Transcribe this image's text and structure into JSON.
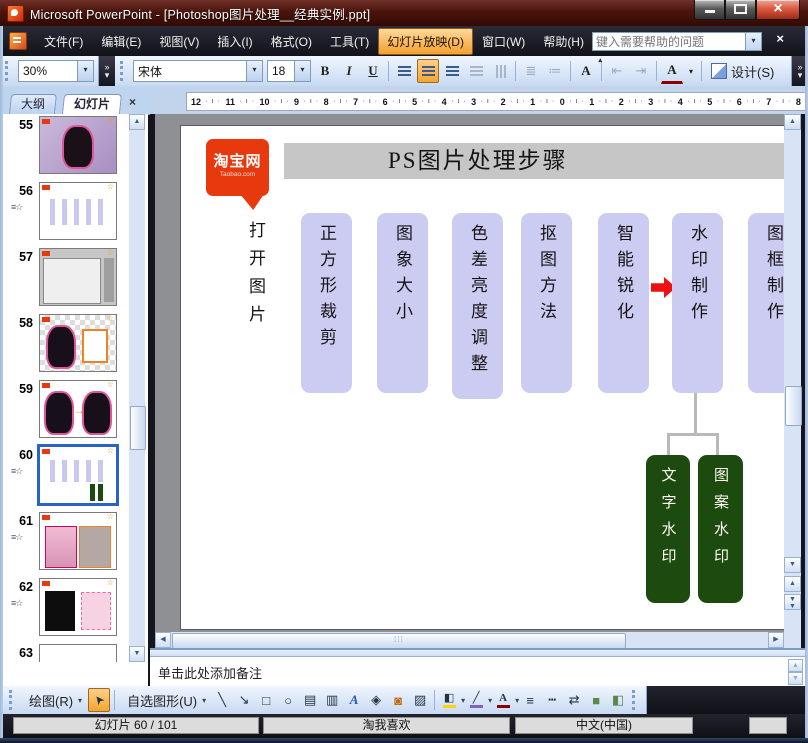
{
  "window": {
    "title": "Microsoft PowerPoint - [Photoshop图片处理__经典实例.ppt]"
  },
  "menu_bar": {
    "items": [
      "文件(F)",
      "编辑(E)",
      "视图(V)",
      "插入(I)",
      "格式(O)",
      "工具(T)",
      "幻灯片放映(D)",
      "窗口(W)",
      "帮助(H)"
    ],
    "active_item": "幻灯片放映(D)",
    "help_placeholder": "键入需要帮助的问题"
  },
  "format_toolbar": {
    "zoom_value": "30%",
    "font_name": "宋体",
    "font_size": "18",
    "bold_label": "B",
    "italic_label": "I",
    "underline_label": "U",
    "increase_font_label": "A",
    "font_color_label": "A",
    "design_label": "设计(S)"
  },
  "tab_bar": {
    "outline_tab": "大纲",
    "slides_tab": "幻灯片"
  },
  "ruler": {
    "numbers": [
      "12",
      "11",
      "10",
      "9",
      "8",
      "7",
      "6",
      "5",
      "4",
      "3",
      "2",
      "1",
      "0",
      "1",
      "2",
      "3",
      "4",
      "5",
      "6",
      "7",
      "8"
    ]
  },
  "slide_panel": {
    "slides": [
      {
        "number": "55",
        "animated": false,
        "kind": "dress-purple",
        "selected": false
      },
      {
        "number": "56",
        "animated": true,
        "kind": "bars",
        "selected": false
      },
      {
        "number": "57",
        "animated": false,
        "kind": "screenshot",
        "selected": false
      },
      {
        "number": "58",
        "animated": false,
        "kind": "dress-checker",
        "selected": false
      },
      {
        "number": "59",
        "animated": false,
        "kind": "two-dresses",
        "selected": false
      },
      {
        "number": "60",
        "animated": true,
        "kind": "bars-green",
        "selected": true
      },
      {
        "number": "61",
        "animated": true,
        "kind": "cats",
        "selected": false
      },
      {
        "number": "62",
        "animated": true,
        "kind": "guitar",
        "selected": false
      },
      {
        "number": "63",
        "animated": false,
        "kind": "partial",
        "selected": false
      }
    ]
  },
  "slide": {
    "logo": {
      "line1": "淘宝网",
      "line2": "Taobao.com"
    },
    "title": "PS图片处理步骤",
    "intro_step": "打开图片",
    "steps": [
      "正方形裁剪",
      "图象大小",
      "色差亮度调整",
      "抠图方法",
      "智能锐化",
      "水印制作",
      "图框制作"
    ],
    "arrow_after_index": 4,
    "substeps": [
      "文字水印",
      "图案水印"
    ],
    "colors": {
      "step_box": "#ccccf2",
      "substep_box": "#1d4a0f",
      "arrow": "#ee1111",
      "logo_red": "#e8380e",
      "slide_title_bar": "#c6c6c6"
    }
  },
  "notes": {
    "placeholder": "单击此处添加备注"
  },
  "drawing_toolbar": {
    "draw_label": "绘图(R)",
    "autoshapes_label": "自选图形(U)"
  },
  "status_bar": {
    "slide_indicator": "幻灯片 60 / 101",
    "center_text": "淘我喜欢",
    "language": "中文(中国)"
  },
  "icons": {
    "animation_star": "≡☆",
    "star": "☆",
    "dropdown": "▾",
    "overflow": "»",
    "scroll_up": "▲",
    "scroll_down": "▼",
    "scroll_left": "◀",
    "scroll_right": "▶",
    "prev_slide": "▲▲",
    "next_slide": "▼▼",
    "grip_dots": "⁞⁞⁞"
  }
}
